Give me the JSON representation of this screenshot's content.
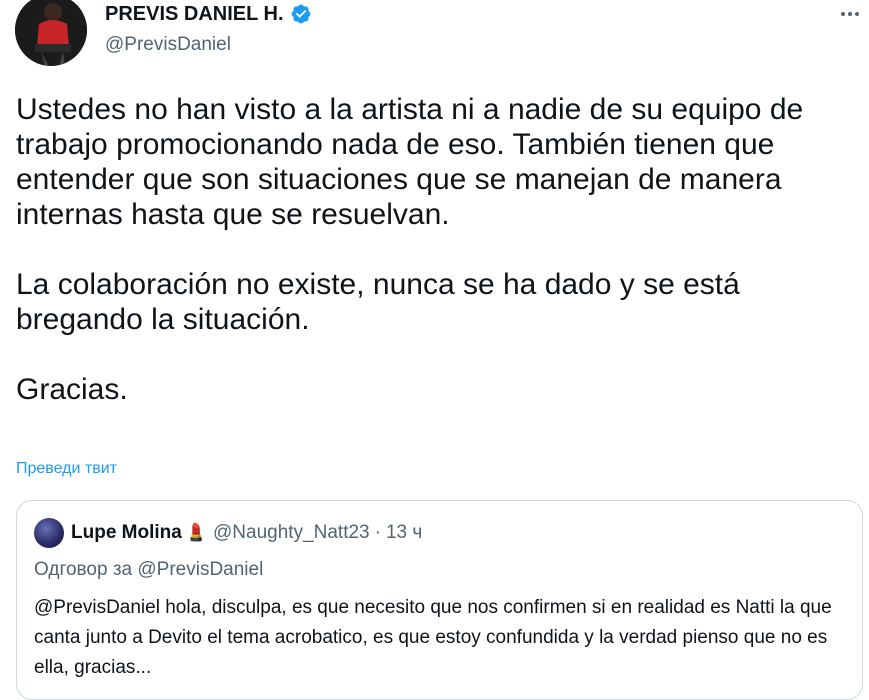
{
  "author": {
    "display_name": "PREVIS DANIEL H.",
    "handle": "@PrevisDaniel",
    "verified": true,
    "badge_color": "#1d9bf0"
  },
  "more_menu": {
    "icon": "more-horizontal-icon"
  },
  "tweet": {
    "text": "Ustedes no han visto a la artista ni a nadie de su equipo de trabajo promocionando nada de eso. También tienen que entender que son situaciones que se manejan de manera internas hasta que se resuelvan.\n\nLa colaboración no existe, nunca se ha dado y se está bregando la situación.\n\nGracias."
  },
  "translate_label": "Преведи твит",
  "quoted_tweet": {
    "display_name": "Lupe Molina",
    "emoji": "💄",
    "handle": "@Naughty_Natt23",
    "separator": "·",
    "time": "13 ч",
    "reply_context": "Одговор за @PrevisDaniel",
    "text": "@PrevisDaniel hola, disculpa, es que necesito que nos confirmen si en realidad es Natti la que canta junto a Devito el tema acrobatico, es que estoy confundida y la verdad pienso que no es ella, gracias..."
  },
  "colors": {
    "text": "#0f1419",
    "secondary": "#536471",
    "link": "#1d9bf0",
    "border": "#cfd9de"
  }
}
